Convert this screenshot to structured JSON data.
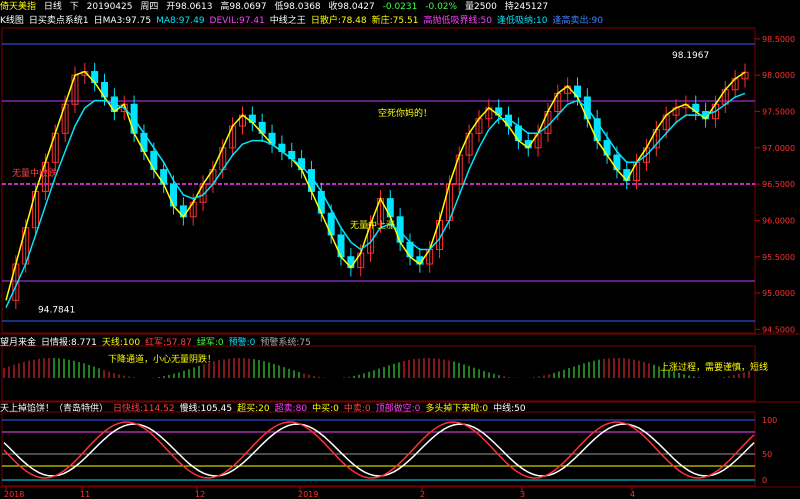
{
  "header": {
    "title": "倚天美指",
    "period": "日线",
    "dir": "下",
    "date": "20190425",
    "weekday": "周四",
    "open": "开98.0613",
    "high": "高98.0697",
    "low": "低98.0368",
    "close": "收98.0427",
    "change": "-0.0231",
    "change_pct": "-0.02%",
    "volume": "量2500",
    "position": "持245127"
  },
  "indicator_line": [
    {
      "text": "K线图",
      "color": "#ffffff"
    },
    {
      "text": "日买卖点系统1",
      "color": "#ffffff"
    },
    {
      "text": "日MA3:97.75",
      "color": "#ffffff"
    },
    {
      "text": "MA8:97.49",
      "color": "#00e5ff"
    },
    {
      "text": "DEVIL:97.41",
      "color": "#ff40ff"
    },
    {
      "text": "中线之王",
      "color": "#ffffff"
    },
    {
      "text": "日散户:78.48",
      "color": "#ffff00"
    },
    {
      "text": "新庄:75.51",
      "color": "#ffff00"
    },
    {
      "text": "高抛低吸界线:50",
      "color": "#ff40ff"
    },
    {
      "text": "逢低吸纳:10",
      "color": "#00e5ff"
    },
    {
      "text": "逢高卖出:90",
      "color": "#4080ff"
    }
  ],
  "panel2_line": [
    {
      "text": "望月来金",
      "color": "#ffffff"
    },
    {
      "text": "日情报:8.771",
      "color": "#ffffff"
    },
    {
      "text": "天线:100",
      "color": "#ffff00"
    },
    {
      "text": "红军:57.87",
      "color": "#ff4040"
    },
    {
      "text": "绿军:0",
      "color": "#40ff40"
    },
    {
      "text": "预警:0",
      "color": "#00e5ff"
    },
    {
      "text": "预警系统:75",
      "color": "#aaaaaa"
    }
  ],
  "panel3_line": [
    {
      "text": "天上掉馅饼！（青岛特供）",
      "color": "#ffffff"
    },
    {
      "text": "日快线:114.52",
      "color": "#ff4040"
    },
    {
      "text": "慢线:105.45",
      "color": "#ffffff"
    },
    {
      "text": "超买:20",
      "color": "#ffff00"
    },
    {
      "text": "超卖:80",
      "color": "#ff40ff"
    },
    {
      "text": "中买:0",
      "color": "#ffff00"
    },
    {
      "text": "中卖:0",
      "color": "#ff4040"
    },
    {
      "text": "顶部做空:0",
      "color": "#ff40ff"
    },
    {
      "text": "多头掉下来啦:0",
      "color": "#ffff00"
    },
    {
      "text": "中线:50",
      "color": "#ffffff"
    }
  ],
  "main_annotations": [
    {
      "text": "94.7841",
      "color": "#ffffff"
    },
    {
      "text": "98.1967",
      "color": "#ffffff"
    },
    {
      "text": "空死你妈的！",
      "color": "#ffff00"
    },
    {
      "text": "无量中收跌",
      "color": "#ff4040"
    },
    {
      "text": "无量中上涨",
      "color": "#ffff00"
    },
    {
      "text": "下降通道，小心无量阴跌！",
      "color": "#ffff00"
    },
    {
      "text": "上涨过程，需要谨慎，短线",
      "color": "#ffff00"
    }
  ],
  "chart_data": {
    "type": "line",
    "title": "倚天美指 日线",
    "x_tick_labels": [
      "2018",
      "11",
      "12",
      "2019",
      "2",
      "3",
      "4"
    ],
    "y_tick_labels": [
      "98.5000",
      "98.0000",
      "97.5000",
      "97.0000",
      "96.5000",
      "96.0000",
      "95.5000",
      "95.0000",
      "94.5000"
    ],
    "ylim": [
      94.45,
      98.65
    ],
    "high_mark": 98.1967,
    "low_mark": 94.7841,
    "panel3_y_tick_labels": [
      "100",
      "50",
      "0"
    ],
    "series": [
      {
        "name": "MA3",
        "values": [
          94.9,
          95.4,
          95.9,
          96.4,
          96.8,
          97.2,
          97.6,
          98.0,
          98.05,
          97.9,
          97.7,
          97.5,
          97.6,
          97.2,
          96.95,
          96.7,
          96.5,
          96.2,
          96.05,
          96.25,
          96.5,
          96.7,
          97.0,
          97.3,
          97.45,
          97.35,
          97.2,
          97.05,
          96.95,
          96.85,
          96.7,
          96.4,
          96.1,
          95.8,
          95.5,
          95.35,
          95.55,
          95.95,
          96.3,
          96.05,
          95.7,
          95.5,
          95.4,
          95.6,
          96.0,
          96.5,
          96.9,
          97.2,
          97.4,
          97.55,
          97.45,
          97.3,
          97.1,
          97.0,
          97.2,
          97.5,
          97.75,
          97.85,
          97.7,
          97.4,
          97.1,
          96.9,
          96.7,
          96.55,
          96.8,
          97.0,
          97.25,
          97.45,
          97.55,
          97.6,
          97.5,
          97.4,
          97.6,
          97.8,
          97.95,
          98.04
        ]
      },
      {
        "name": "MA8",
        "values": [
          94.8,
          95.1,
          95.4,
          95.8,
          96.2,
          96.6,
          96.95,
          97.3,
          97.55,
          97.65,
          97.65,
          97.6,
          97.55,
          97.4,
          97.2,
          97.0,
          96.8,
          96.55,
          96.35,
          96.3,
          96.35,
          96.5,
          96.7,
          96.9,
          97.05,
          97.1,
          97.1,
          97.05,
          96.95,
          96.85,
          96.75,
          96.6,
          96.4,
          96.15,
          95.9,
          95.7,
          95.6,
          95.7,
          95.9,
          95.95,
          95.85,
          95.7,
          95.6,
          95.6,
          95.75,
          96.0,
          96.35,
          96.7,
          97.0,
          97.25,
          97.4,
          97.4,
          97.3,
          97.2,
          97.2,
          97.3,
          97.45,
          97.6,
          97.65,
          97.55,
          97.35,
          97.15,
          96.95,
          96.8,
          96.8,
          96.9,
          97.05,
          97.2,
          97.35,
          97.45,
          97.45,
          97.45,
          97.5,
          97.6,
          97.7,
          97.75
        ]
      }
    ]
  }
}
